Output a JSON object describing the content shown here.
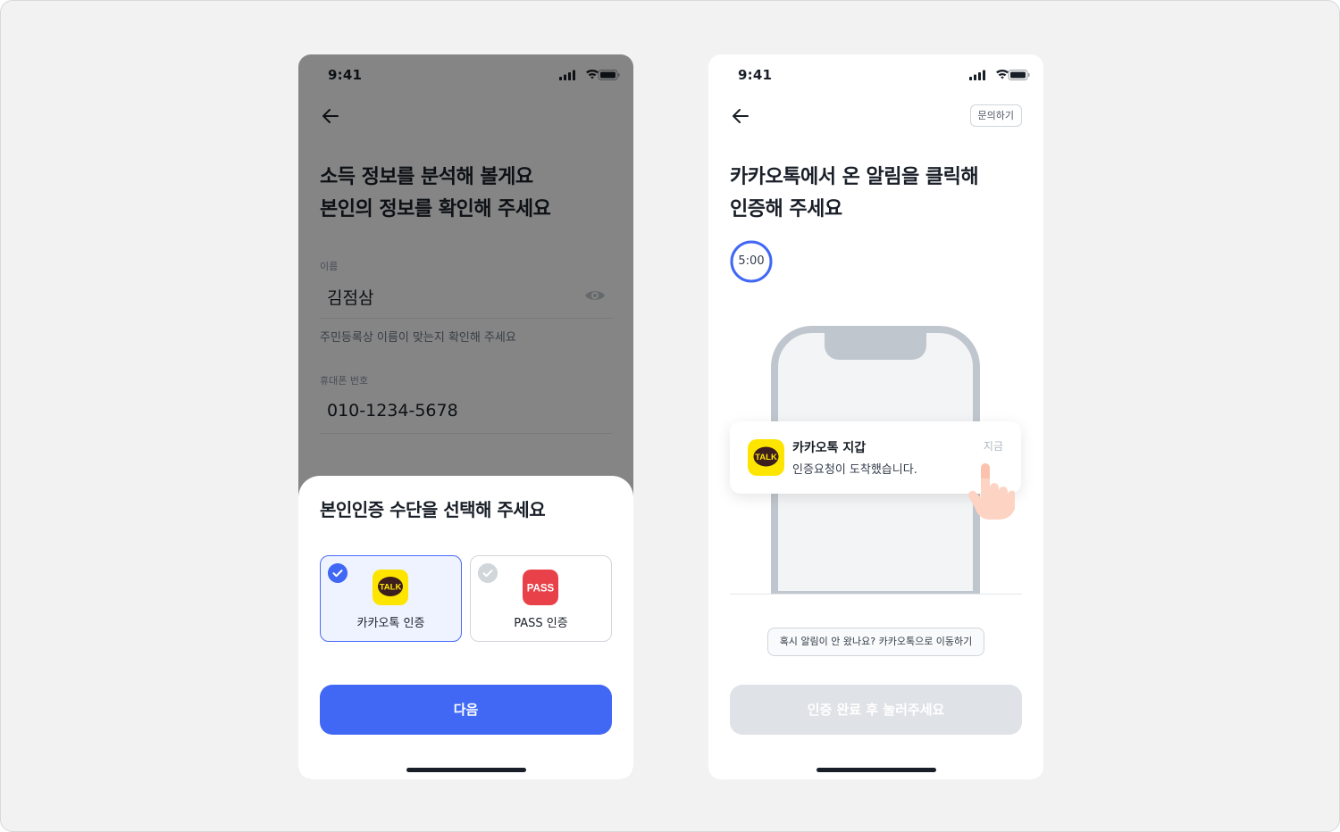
{
  "left_screen": {
    "status_time": "9:41",
    "title_line1": "소득 정보를 분석해 볼게요",
    "title_line2": "본인의 정보를 확인해 주세요",
    "name_label": "이름",
    "name_value": "김점삼",
    "name_help": "주민등록상 이름이 맞는지 확인해 주세요",
    "phone_label": "휴대폰 번호",
    "phone_value": "010-1234-5678",
    "sheet": {
      "title": "본인인증 수단을 선택해 주세요",
      "options": [
        {
          "label": "카카오톡 인증",
          "logo_text": "TALK",
          "selected": true,
          "logo_color": "#fee500"
        },
        {
          "label": "PASS 인증",
          "logo_text": "PASS",
          "selected": false,
          "logo_color": "#e8414a"
        }
      ],
      "next_button": "다음"
    }
  },
  "right_screen": {
    "status_time": "9:41",
    "inquiry_button": "문의하기",
    "title_line1": "카카오톡에서 온 알림을 클릭해",
    "title_line2": "인증해 주세요",
    "timer": "5:00",
    "notification": {
      "app": "카카오톡 지갑",
      "message": "인증요청이 도착했습니다.",
      "time": "지금",
      "logo_text": "TALK"
    },
    "kakao_link": "혹시 알림이 안 왔나요? 카카오톡으로 이동하기",
    "complete_button": "인증 완료 후 눌러주세요"
  },
  "colors": {
    "primary": "#4168f5",
    "kakao_yellow": "#fee500",
    "pass_red": "#e8414a",
    "disabled": "#dfe2e6"
  }
}
